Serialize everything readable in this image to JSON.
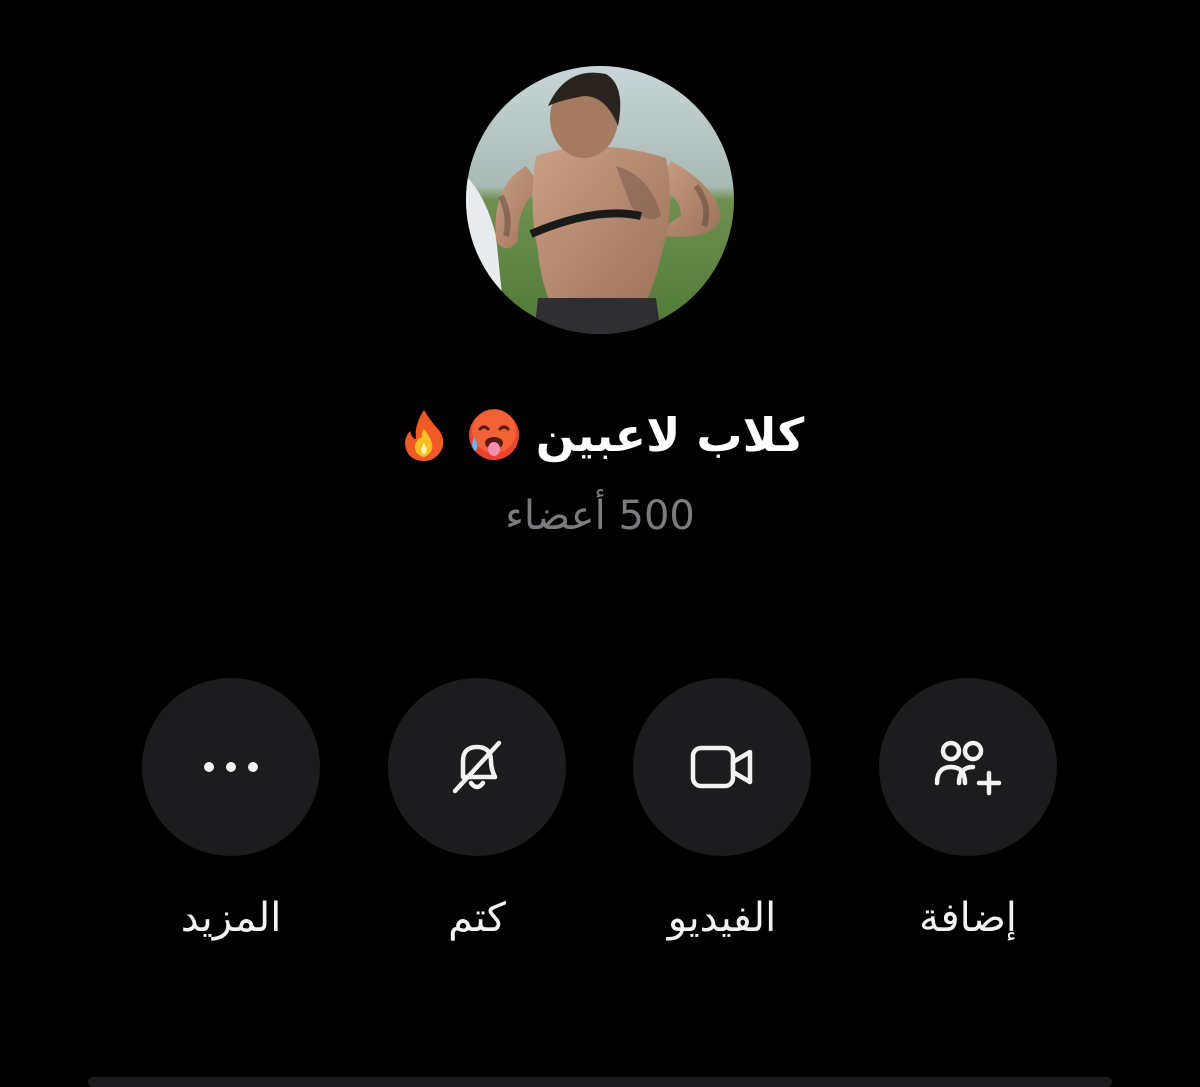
{
  "profile": {
    "name": "كلاب لاعبين",
    "title_emojis": [
      "hot-face-icon",
      "fire-icon"
    ],
    "members": "500 أعضاء"
  },
  "actions": [
    {
      "label": "إضافة",
      "icon": "add-member-icon"
    },
    {
      "label": "الفيديو",
      "icon": "video-icon"
    },
    {
      "label": "كتم",
      "icon": "mute-bell-icon"
    },
    {
      "label": "المزيد",
      "icon": "more-dots-icon"
    }
  ],
  "colors": {
    "background": "#000000",
    "button_background": "#1c1c1e",
    "secondary_text": "#7c7c80",
    "primary_text": "#ffffff"
  }
}
